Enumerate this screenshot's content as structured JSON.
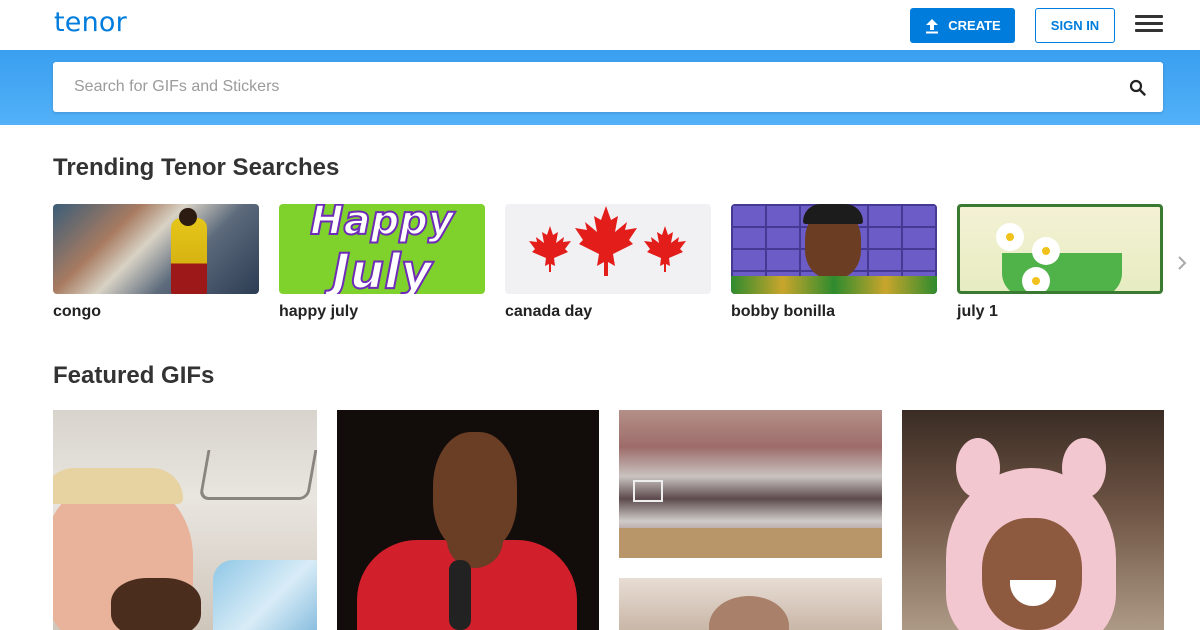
{
  "header": {
    "logo": "tenor",
    "create_label": "CREATE",
    "signin_label": "SIGN IN",
    "icons": {
      "upload": "upload-icon",
      "menu": "hamburger-menu-icon"
    }
  },
  "search": {
    "placeholder": "Search for GIFs and Stickers",
    "value": "",
    "icon": "search-icon"
  },
  "trending": {
    "title": "Trending Tenor Searches",
    "items": [
      {
        "label": "congo"
      },
      {
        "label": "happy july",
        "thumb_text": [
          "Happy",
          "July"
        ]
      },
      {
        "label": "canada day"
      },
      {
        "label": "bobby bonilla"
      },
      {
        "label": "july 1"
      }
    ],
    "next_icon": "chevron-right-icon"
  },
  "featured": {
    "title": "Featured GIFs"
  },
  "colors": {
    "brand": "#007ddc",
    "search_band": "#4aaaf5",
    "heading_text": "#333333"
  }
}
